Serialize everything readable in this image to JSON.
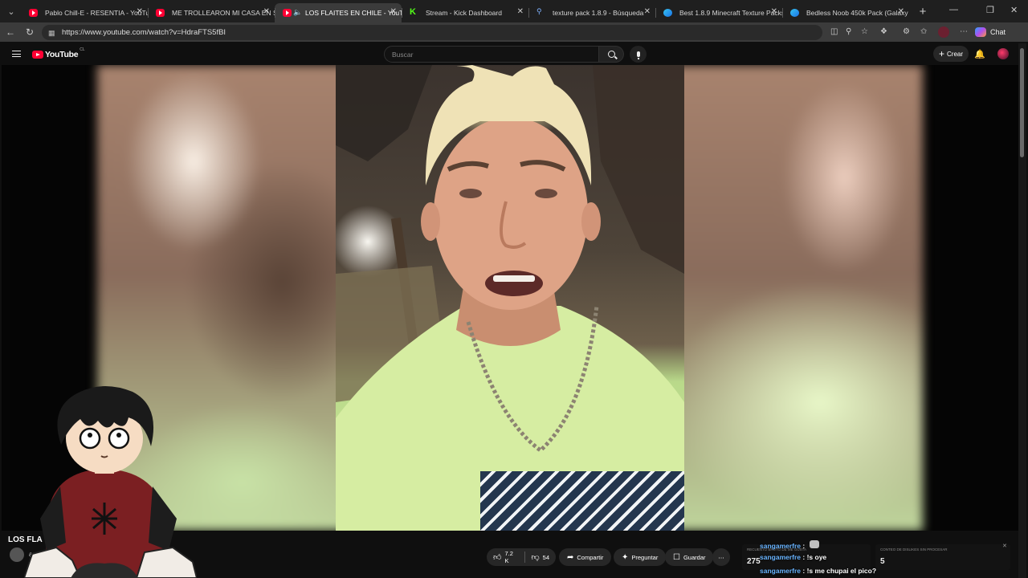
{
  "browser": {
    "tabs": [
      {
        "title": "Pablo Chill-E - RESENTIA - YouTub",
        "icon": "youtube-icon",
        "active": false
      },
      {
        "title": "ME TROLLEARON MI CASA EN SU",
        "icon": "youtube-icon",
        "active": false
      },
      {
        "title": "LOS FLAITES EN CHILE - YouT",
        "icon": "youtube-icon",
        "active": true
      },
      {
        "title": "Stream - Kick Dashboard",
        "icon": "kick-icon",
        "active": false
      },
      {
        "title": "texture pack 1.8.9 - Búsqueda",
        "icon": "search-icon",
        "active": false
      },
      {
        "title": "Best 1.8.9 Minecraft Texture Packs",
        "icon": "edge-icon",
        "active": false
      },
      {
        "title": "Bedless Noob 450k Pack (Galaxy",
        "icon": "edge-icon",
        "active": false
      }
    ],
    "url": "https://www.youtube.com/watch?v=HdraFTS5fBI",
    "chat_label": "Chat"
  },
  "youtube": {
    "logo_text": "YouTube",
    "country_code": "CL",
    "search_placeholder": "Buscar",
    "create_label": "Crear",
    "video_title": "LOS FLA",
    "channel_label": "an",
    "actions": {
      "likes": "7.2 K",
      "dislikes": "54",
      "share": "Compartir",
      "ask": "Preguntar",
      "save": "Guardar"
    }
  },
  "overlay": {
    "boxes": [
      {
        "caption": "RECUENTO BRUTO DE ME GUSTA",
        "value": "275"
      },
      {
        "caption": "CONTEO DE DISLIKES SIN PROCESAR",
        "value": "5"
      }
    ],
    "chat": [
      {
        "user": "sangamerfre",
        "sep": " :",
        "message": ""
      },
      {
        "user": "sangamerfre",
        "sep": " :",
        "message": " !s oye"
      },
      {
        "user": "sangamerfre",
        "sep": " :",
        "message": " !s me chupai el pico?"
      }
    ]
  },
  "colors": {
    "youtube_red": "#ff0033",
    "kick_green": "#53fc18",
    "chat_user": "#69b4ff",
    "background": "#0f0f0f"
  }
}
